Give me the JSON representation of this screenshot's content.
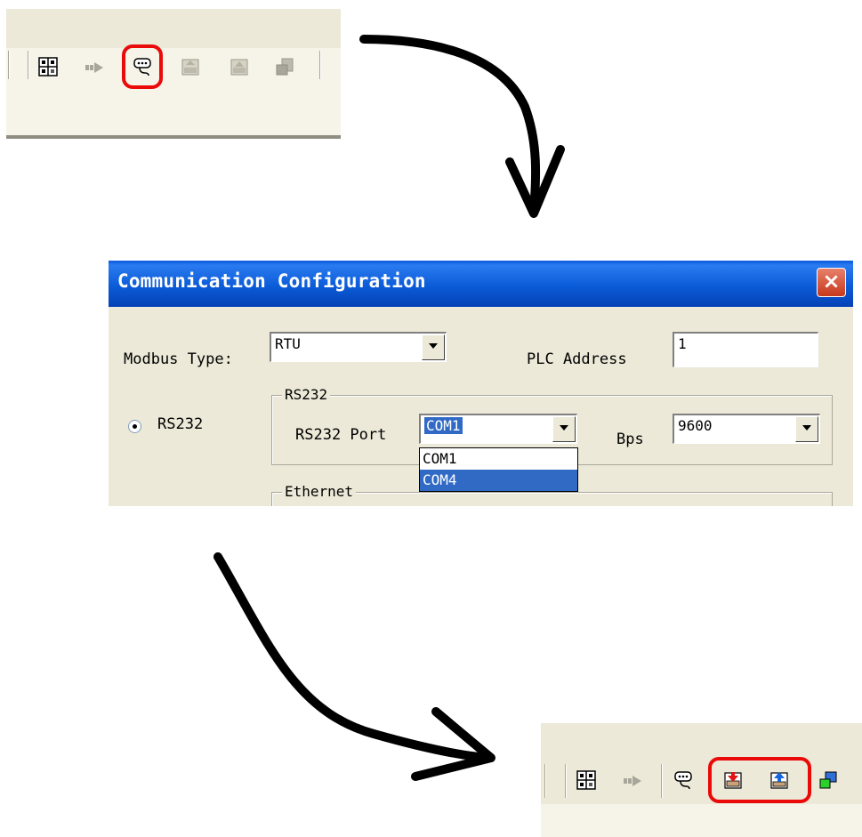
{
  "toolbar_top": {
    "icons": [
      "grid-icon",
      "run-icon",
      "communication-icon",
      "download-icon",
      "upload-icon",
      "stop-icon"
    ],
    "highlighted": "communication-icon"
  },
  "dialog": {
    "title": "Communication Configuration",
    "close_label": "×",
    "modbus_type_label": "Modbus Type:",
    "modbus_type_value": "RTU",
    "plc_address_label": "PLC Address",
    "plc_address_value": "1",
    "rs232_radio_label": "RS232",
    "rs232_group_label": "RS232",
    "rs232_port_label": "RS232 Port",
    "rs232_port_value": "COM1",
    "bps_label": "Bps",
    "bps_value": "9600",
    "port_options": [
      "COM1",
      "COM4"
    ],
    "port_options_highlighted": "COM4",
    "ethernet_group_label": "Ethernet"
  },
  "toolbar_bottom": {
    "icons": [
      "grid-icon",
      "run-icon",
      "communication-icon",
      "download-icon",
      "upload-icon",
      "network-icon"
    ],
    "highlighted": [
      "download-icon",
      "upload-icon"
    ]
  },
  "colors": {
    "highlight": "#ea0a0a",
    "titlebar": "#0b5cd8",
    "selection": "#316ac5",
    "panel": "#ece9d8"
  }
}
